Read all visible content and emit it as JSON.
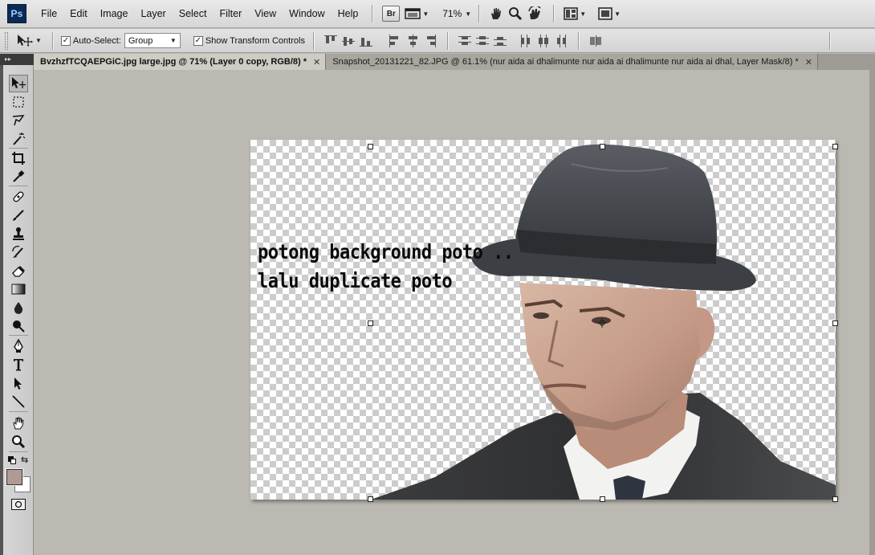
{
  "app": {
    "logo": "Ps"
  },
  "menu": [
    "File",
    "Edit",
    "Image",
    "Layer",
    "Select",
    "Filter",
    "View",
    "Window",
    "Help"
  ],
  "appbar": {
    "bridge_label": "Br",
    "zoom": "71%"
  },
  "options": {
    "auto_select_label": "Auto-Select:",
    "auto_select_value": "Group",
    "show_transform_label": "Show Transform Controls"
  },
  "tabs": [
    {
      "label": "BvzhzfTCQAEPGiC.jpg large.jpg @ 71% (Layer 0 copy, RGB/8) *",
      "active": true
    },
    {
      "label": "Snapshot_20131221_82.JPG @ 61.1% (nur aida ai dhalimunte nur aida ai dhalimunte  nur aida ai dhal, Layer Mask/8) *",
      "active": false
    }
  ],
  "tab_close": "✕",
  "panel_collapse": "▸▸",
  "canvas": {
    "text_line1": "potong background poto ..",
    "text_line2": "lalu duplicate poto"
  },
  "colors": {
    "foreground": "#b09a96",
    "background": "#ffffff"
  }
}
